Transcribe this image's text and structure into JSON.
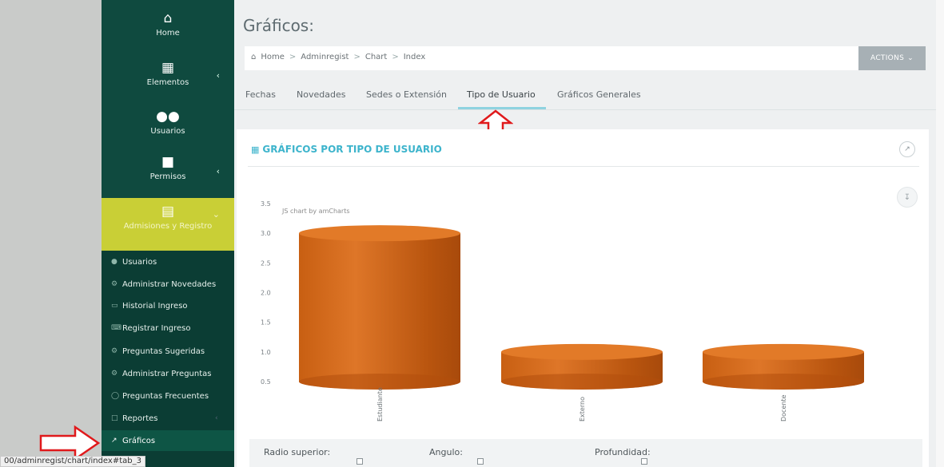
{
  "sidebar": {
    "items": [
      {
        "label": "Home",
        "icon": "home-icon"
      },
      {
        "label": "Elementos",
        "icon": "building-icon"
      },
      {
        "label": "Usuarios",
        "icon": "users-icon"
      },
      {
        "label": "Permisos",
        "icon": "lock-icon"
      },
      {
        "label": "Admisiones y Registro",
        "icon": "book-icon"
      }
    ],
    "subitems": [
      {
        "label": "Usuarios",
        "icon": "user-icon"
      },
      {
        "label": "Administrar Novedades",
        "icon": "cogs-icon"
      },
      {
        "label": "Historial Ingreso",
        "icon": "monitor-icon"
      },
      {
        "label": "Registrar Ingreso",
        "icon": "keyboard-icon"
      },
      {
        "label": "Preguntas Sugeridas",
        "icon": "cogs-icon"
      },
      {
        "label": "Administrar Preguntas",
        "icon": "cogs-icon"
      },
      {
        "label": "Preguntas Frecuentes",
        "icon": "lifebuoy-icon"
      },
      {
        "label": "Reportes",
        "icon": "file-icon"
      },
      {
        "label": "Gráficos",
        "icon": "line-chart-icon"
      }
    ],
    "colors": {
      "bg": "#0f4a3f",
      "active": "#c9cf36"
    }
  },
  "header": {
    "title": "Gráficos:",
    "breadcrumb": [
      "Home",
      "Adminregist",
      "Chart",
      "Index"
    ],
    "actions_label": "ACTIONS"
  },
  "tabs": [
    {
      "label": "Fechas"
    },
    {
      "label": "Novedades"
    },
    {
      "label": "Sedes o Extensión"
    },
    {
      "label": "Tipo de Usuario",
      "active": true
    },
    {
      "label": "Gráficos Generales"
    }
  ],
  "panel": {
    "title": "GRÁFICOS POR TIPO DE USUARIO",
    "watermark": "JS chart by amCharts",
    "controls": [
      "Radio superior:",
      "Angulo:",
      "Profundidad:"
    ]
  },
  "status_url": "00/adminregist/chart/index#tab_3",
  "chart_data": {
    "type": "bar",
    "categories": [
      "Estudiante",
      "Externo",
      "Docente"
    ],
    "values": [
      3,
      1,
      1
    ],
    "y_ticks": [
      "3.5",
      "3.0",
      "2.5",
      "2.0",
      "1.5",
      "1.0",
      "0.5"
    ],
    "y_tick_values": [
      3.5,
      3.0,
      2.5,
      2.0,
      1.5,
      1.0,
      0.5
    ],
    "ylim": [
      0.5,
      3.5
    ],
    "color": "#d2691e"
  }
}
